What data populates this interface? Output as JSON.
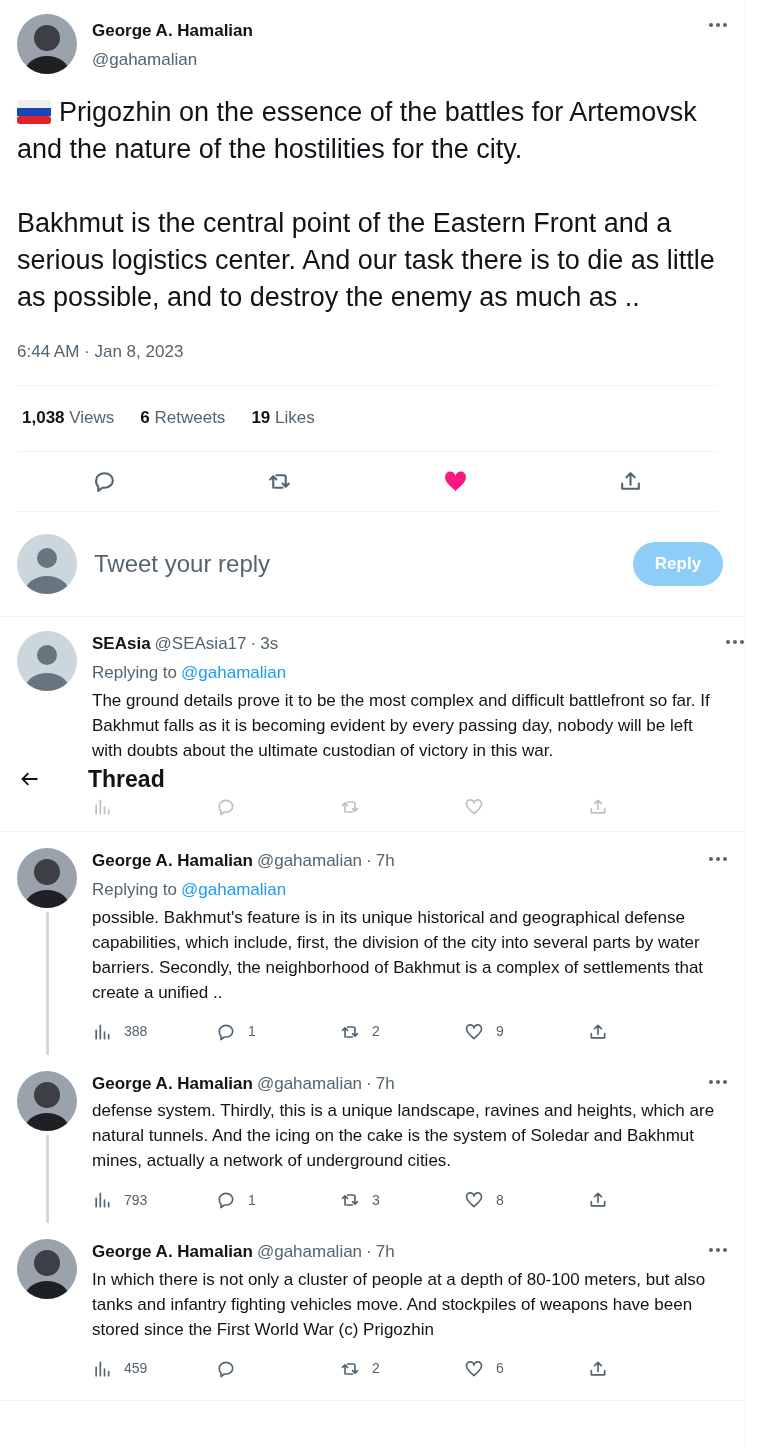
{
  "main_tweet": {
    "name": "George A. Hamalian",
    "handle": "@gahamalian",
    "paragraphs": [
      "Prigozhin on the essence of the battles for Artemovsk and the nature of the hostilities for the city.",
      "Bakhmut is the central point of the Eastern Front and a serious logistics center. And our task there is to die as little as possible, and to destroy the enemy as much as .."
    ],
    "timestamp": "6:44 AM · Jan 8, 2023",
    "stats": [
      "**1,038** Views",
      "**6** Retweets",
      "**19** Likes"
    ],
    "liked": true
  },
  "composer": {
    "placeholder": "Tweet your reply",
    "button": "Reply"
  },
  "header": {
    "title": "Thread"
  },
  "reply": {
    "name": "SEAsia",
    "handle": "@SEAsia17",
    "separator": "·",
    "time": "3s",
    "replying_label": "Replying to",
    "replying_handle": "@gahamalian",
    "text": "The ground details prove it to be the most complex and difficult battlefront so far. If Bakhmut falls as it is becoming evident by every passing day, nobody will be left with doubts about the ultimate custodian of victory in this war."
  },
  "thread": [
    {
      "name": "George A. Hamalian",
      "handle": "@gahamalian",
      "separator": "·",
      "time": "7h",
      "replying_label": "Replying to",
      "replying_handle": "@gahamalian",
      "text": "possible. Bakhmut's feature is in its unique historical and geographical defense capabilities, which include, first, the division of the city into several parts by water barriers. Secondly, the neighborhood of Bakhmut is a complex of settlements that create a unified ..",
      "views": "388",
      "replies": "1",
      "retweets": "2",
      "likes": "9",
      "liked": false,
      "connector": true
    },
    {
      "name": "George A. Hamalian",
      "handle": "@gahamalian",
      "separator": "·",
      "time": "7h",
      "text": "defense system. Thirdly, this is a unique landscape, ravines and heights, which are natural tunnels. And the icing on the cake is the system of Soledar and Bakhmut mines, actually a network of underground cities.",
      "views": "793",
      "replies": "1",
      "retweets": "3",
      "likes": "8",
      "liked": false,
      "connector": true
    },
    {
      "name": "George A. Hamalian",
      "handle": "@gahamalian",
      "separator": "·",
      "time": "7h",
      "text": "In which there is not only a cluster of people at a depth of 80-100 meters, but also tanks and infantry fighting vehicles move. And stockpiles of weapons have been stored since the First World War (c) Prigozhin",
      "views": "459",
      "likes": "6",
      "retweets": "2",
      "liked": false,
      "connector": false
    }
  ]
}
